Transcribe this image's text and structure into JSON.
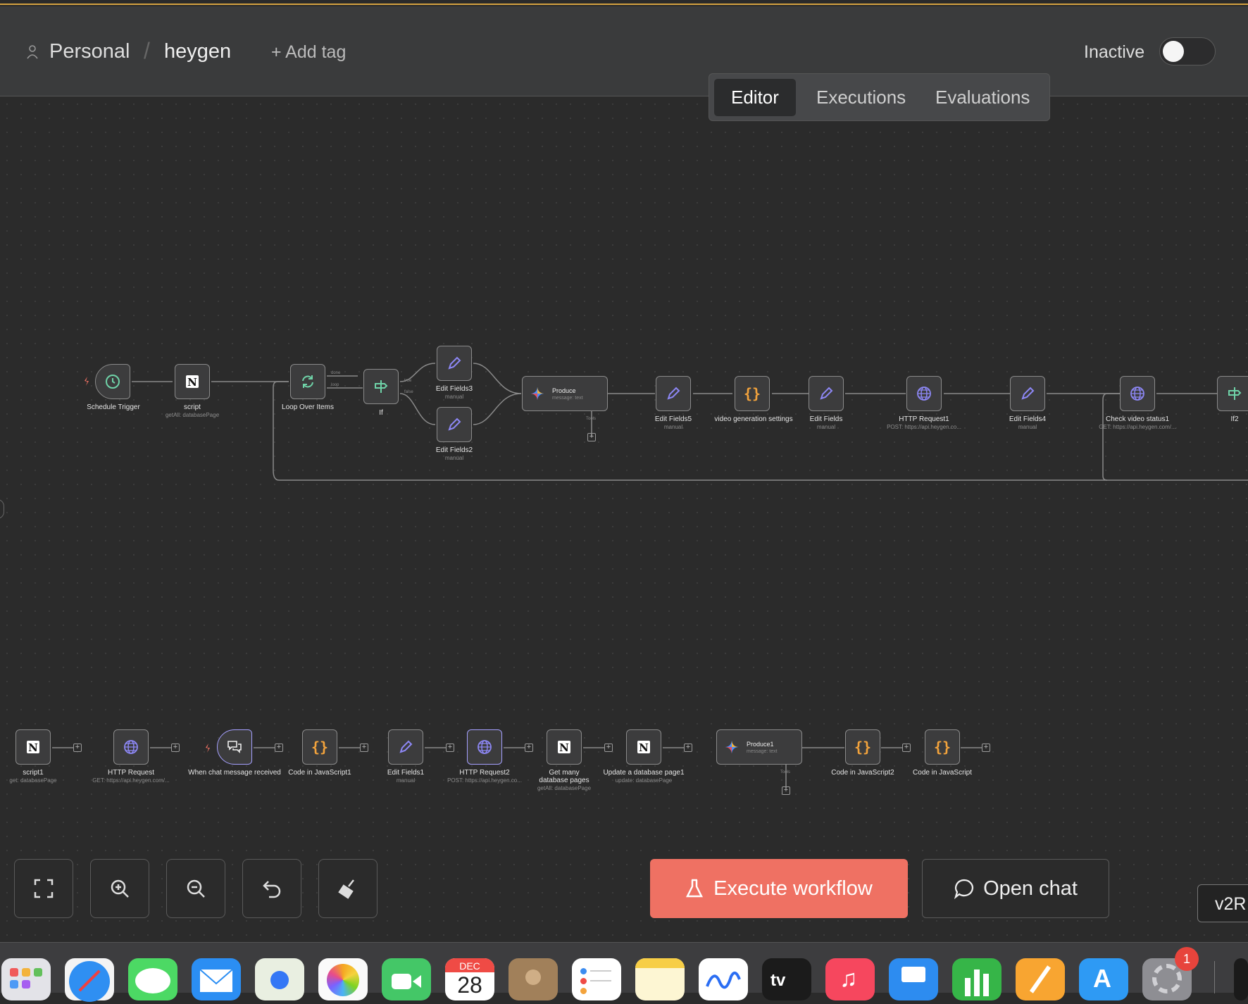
{
  "header": {
    "project": "Personal",
    "workflow": "heygen",
    "add_tag": "+ Add tag",
    "status_label": "Inactive"
  },
  "tabs": [
    "Editor",
    "Executions",
    "Evaluations"
  ],
  "flow_nodes": [
    {
      "id": "n1",
      "label": "Schedule Trigger",
      "sub": "",
      "icon": "clock-icon"
    },
    {
      "id": "n2",
      "label": "script",
      "sub": "getAll: databasePage",
      "icon": "notion-icon"
    },
    {
      "id": "n3",
      "label": "Loop Over Items",
      "sub": "",
      "icon": "loop-icon"
    },
    {
      "id": "n4",
      "label": "If",
      "sub": "",
      "icon": "if-icon"
    },
    {
      "id": "n5",
      "label": "Edit Fields3",
      "sub": "manual",
      "icon": "pencil-icon"
    },
    {
      "id": "n6",
      "label": "Edit Fields2",
      "sub": "manual",
      "icon": "pencil-icon"
    },
    {
      "id": "n7",
      "label": "Produce",
      "sub": "message: text",
      "icon": "gemini-icon",
      "inner_title": "Produce",
      "port": "Tools"
    },
    {
      "id": "n8",
      "label": "Edit Fields5",
      "sub": "manual",
      "icon": "pencil-icon"
    },
    {
      "id": "n9",
      "label": "video generation settings",
      "sub": "",
      "icon": "code-icon"
    },
    {
      "id": "n10",
      "label": "Edit Fields",
      "sub": "manual",
      "icon": "pencil-icon"
    },
    {
      "id": "n11",
      "label": "HTTP Request1",
      "sub": "POST: https://api.heygen.co...",
      "icon": "globe-icon"
    },
    {
      "id": "n12",
      "label": "Edit Fields4",
      "sub": "manual",
      "icon": "pencil-icon"
    },
    {
      "id": "n13",
      "label": "Check video status1",
      "sub": "GET: https://api.heygen.com/...",
      "icon": "globe-icon"
    },
    {
      "id": "n14",
      "label": "If2",
      "sub": "",
      "icon": "if-icon"
    }
  ],
  "branch_labels": {
    "done": "done",
    "loop": "loop",
    "true": "true",
    "false": "false"
  },
  "bottom_nodes": [
    {
      "label": "script1",
      "sub": "get: databasePage",
      "icon": "notion-icon"
    },
    {
      "label": "HTTP Request",
      "sub": "GET: https://api.heygen.com/...",
      "icon": "globe-icon"
    },
    {
      "label": "When chat message received",
      "sub": "",
      "icon": "chat-icon"
    },
    {
      "label": "Code in JavaScript1",
      "sub": "",
      "icon": "code-icon"
    },
    {
      "label": "Edit Fields1",
      "sub": "manual",
      "icon": "pencil-icon"
    },
    {
      "label": "HTTP Request2",
      "sub": "POST: https://api.heygen.co...",
      "icon": "globe-icon"
    },
    {
      "label": "Get many database pages",
      "sub": "getAll: databasePage",
      "icon": "notion-icon"
    },
    {
      "label": "Update a database page1",
      "sub": "update: databasePage",
      "icon": "notion-icon"
    },
    {
      "label": "Produce1",
      "sub": "message: text",
      "icon": "gemini-icon",
      "inner_title": "Produce1",
      "port": "Tools"
    },
    {
      "label": "Code in JavaScript2",
      "sub": "",
      "icon": "code-icon"
    },
    {
      "label": "Code in JavaScript",
      "sub": "",
      "icon": "code-icon"
    }
  ],
  "controls": [
    "fit-view-icon",
    "zoom-in-icon",
    "zoom-out-icon",
    "undo-icon",
    "tidy-up-icon"
  ],
  "actions": {
    "execute": "Execute workflow",
    "chat": "Open chat",
    "version": "v2R"
  },
  "dock": {
    "calendar_month": "DEC",
    "calendar_day": "28",
    "settings_badge": "1"
  },
  "colors": {
    "accent_execute": "#ef7163",
    "pencil": "#8d87f5",
    "code": "#f3a33c",
    "green": "#6fd3a8",
    "globe": "#8d87f5"
  }
}
